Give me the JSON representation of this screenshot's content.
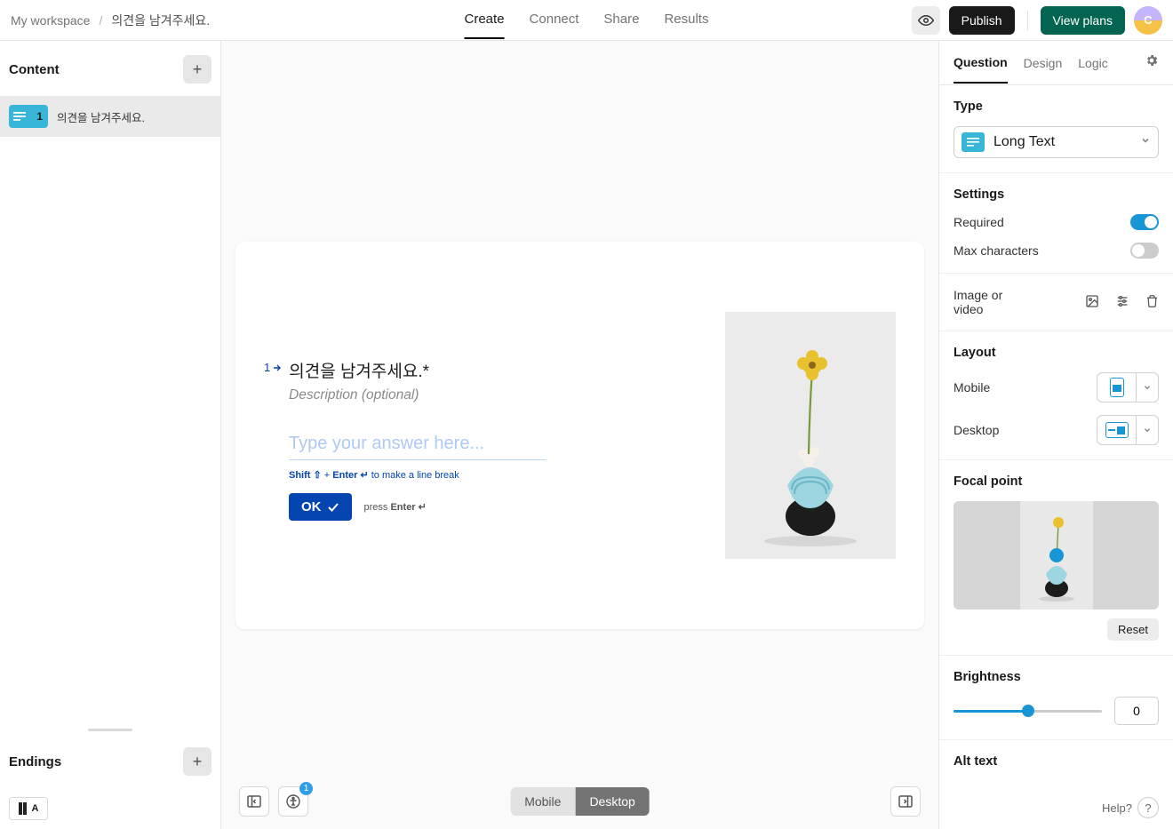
{
  "breadcrumb": {
    "workspace": "My workspace",
    "sep": "/",
    "form": "의견을 남겨주세요."
  },
  "topTabs": {
    "create": "Create",
    "connect": "Connect",
    "share": "Share",
    "results": "Results"
  },
  "topRight": {
    "publish": "Publish",
    "viewPlans": "View plans",
    "avatar": "C"
  },
  "left": {
    "contentHeader": "Content",
    "q1": {
      "num": "1",
      "label": "의견을 남겨주세요."
    },
    "endingsHeader": "Endings",
    "endingLetter": "A"
  },
  "card": {
    "qnum": "1",
    "title": "의견을 남겨주세요.*",
    "desc": "Description (optional)",
    "placeholder": "Type your answer here...",
    "hintShift": "Shift ⇧",
    "hintPlus": "+",
    "hintEnter": "Enter ↵",
    "hintRest": "to make a line break",
    "ok": "OK",
    "pressPrefix": "press ",
    "pressKey": "Enter ↵"
  },
  "bottom": {
    "badge": "1",
    "mobile": "Mobile",
    "desktop": "Desktop"
  },
  "right": {
    "tabs": {
      "question": "Question",
      "design": "Design",
      "logic": "Logic"
    },
    "type": {
      "header": "Type",
      "value": "Long Text"
    },
    "settings": {
      "header": "Settings",
      "required": "Required",
      "maxchars": "Max characters"
    },
    "image": {
      "label": "Image or video"
    },
    "layout": {
      "header": "Layout",
      "mobile": "Mobile",
      "desktop": "Desktop"
    },
    "focal": {
      "header": "Focal point",
      "reset": "Reset"
    },
    "brightness": {
      "header": "Brightness",
      "value": "0"
    },
    "alttext": {
      "header": "Alt text"
    },
    "help": "Help?"
  }
}
